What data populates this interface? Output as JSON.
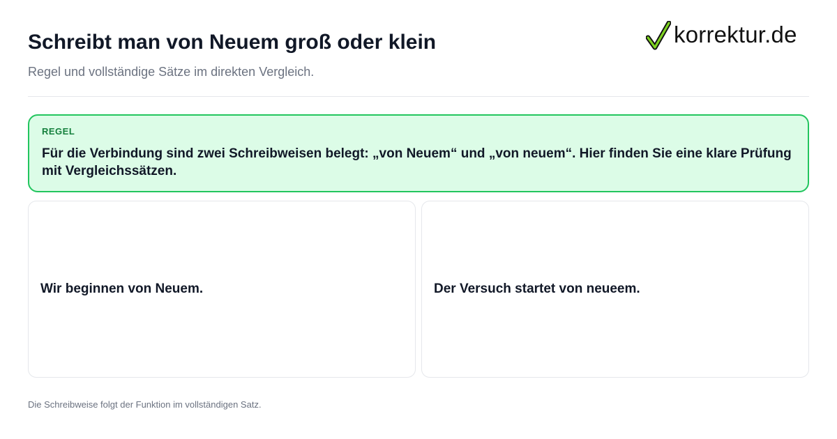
{
  "header": {
    "title": "Schreibt man von Neuem groß oder klein",
    "subtitle": "Regel und vollständige Sätze im direkten Vergleich."
  },
  "logo": {
    "text": "korrektur.de",
    "icon": "checkmark-icon",
    "accent_color": "#7ed321"
  },
  "rule": {
    "label": "REGEL",
    "text": "Für die Verbindung sind zwei Schreibweisen belegt: „von Neuem“ und „von neuem“. Hier finden Sie eine klare Prüfung mit Vergleichssätzen.",
    "background_color": "#dcfce7",
    "border_color": "#22c55e"
  },
  "comparison": {
    "left_sentence": "Wir beginnen von Neuem.",
    "right_sentence": "Der Versuch startet von neueem."
  },
  "footer": {
    "note": "Die Schreibweise folgt der Funktion im vollständigen Satz."
  }
}
